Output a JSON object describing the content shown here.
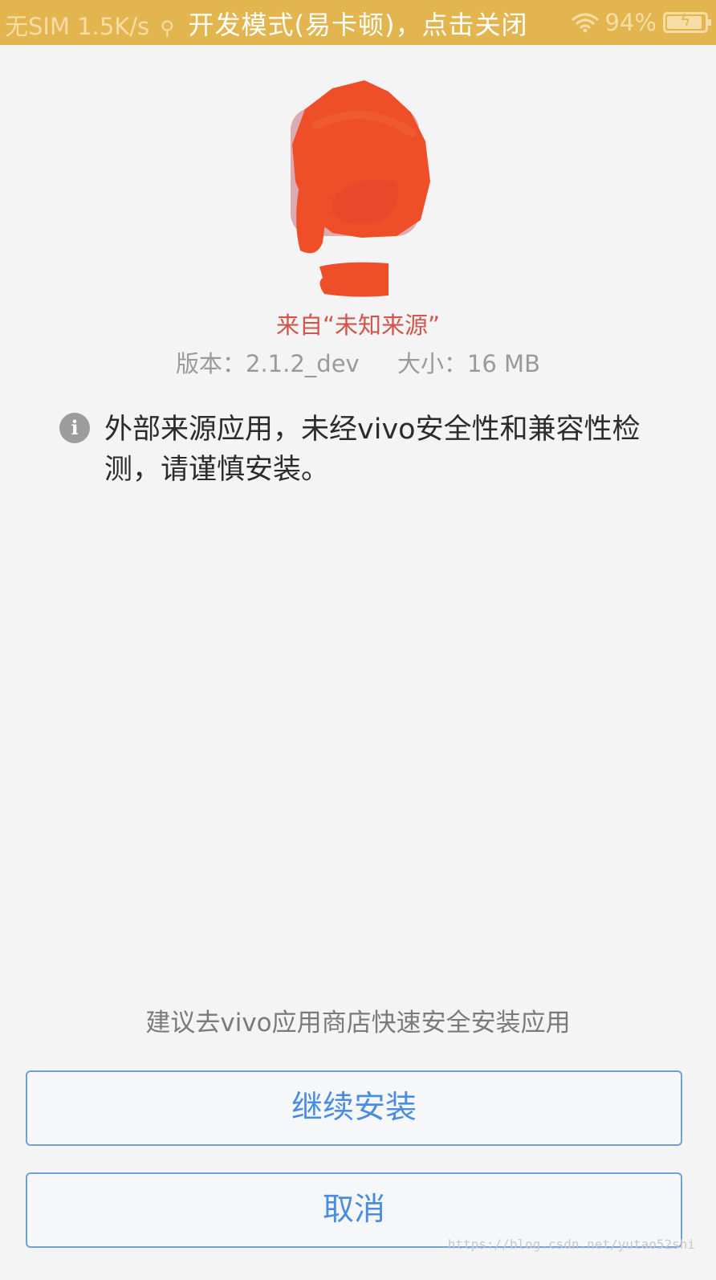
{
  "status_bar": {
    "carrier": "无SIM",
    "speed": "1.5K/s",
    "dev_banner": "开发模式(易卡顿)，点击关闭",
    "battery_percent": "94%",
    "battery_level": 0.94,
    "background_color": "#e3b54f",
    "icons": [
      "usb-icon",
      "wifi-icon",
      "battery-charging-icon"
    ]
  },
  "app": {
    "icon": "app-icon-redacted",
    "source": "来自“未知来源”",
    "version_label": "版本：2.1.2_dev",
    "size_label": "大小：16 MB"
  },
  "warning": {
    "icon": "info-icon",
    "text": "外部来源应用，未经vivo安全性和兼容性检测，请谨慎安装。"
  },
  "suggestion": "建议去vivo应用商店快速安全安装应用",
  "buttons": {
    "continue_label": "继续安装",
    "cancel_label": "取消",
    "accent_color": "#4a8de0"
  },
  "watermark": "https://blog.csdn.net/yutao52shi"
}
